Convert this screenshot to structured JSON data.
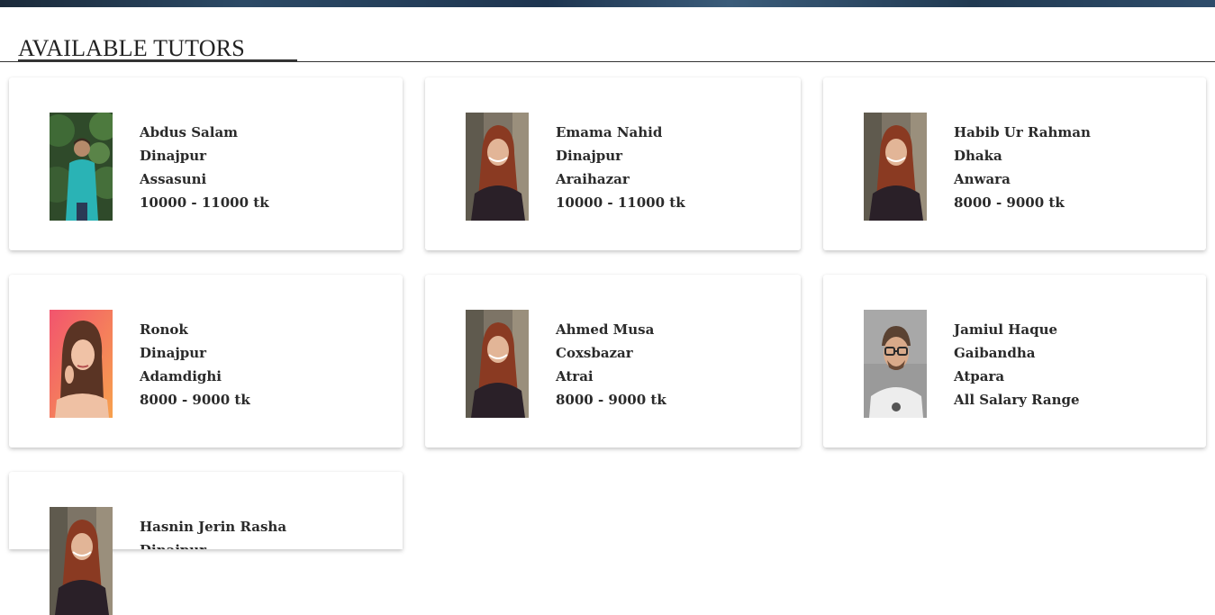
{
  "section": {
    "title": "AVAILABLE TUTORS"
  },
  "tutors": [
    {
      "name": "Abdus Salam",
      "district": "Dinajpur",
      "area": "Assasuni",
      "salary": "10000 - 11000 tk",
      "photo": "man-green-shirt"
    },
    {
      "name": "Emama Nahid",
      "district": "Dinajpur",
      "area": "Araihazar",
      "salary": "10000 - 11000 tk",
      "photo": "woman-red-hair"
    },
    {
      "name": "Habib Ur Rahman",
      "district": "Dhaka",
      "area": "Anwara",
      "salary": "8000 - 9000 tk",
      "photo": "woman-red-hair"
    },
    {
      "name": "Ronok",
      "district": "Dinajpur",
      "area": "Adamdighi",
      "salary": "8000 - 9000 tk",
      "photo": "woman-pink-background"
    },
    {
      "name": "Ahmed Musa",
      "district": "Coxsbazar",
      "area": "Atrai",
      "salary": "8000 - 9000 tk",
      "photo": "woman-red-hair"
    },
    {
      "name": "Jamiul Haque",
      "district": "Gaibandha",
      "area": "Atpara",
      "salary": "All Salary Range",
      "photo": "man-glasses"
    },
    {
      "name": "Hasnin Jerin Rasha",
      "district": "Dinajpur",
      "area": "",
      "salary": "",
      "photo": "woman-red-hair"
    }
  ]
}
